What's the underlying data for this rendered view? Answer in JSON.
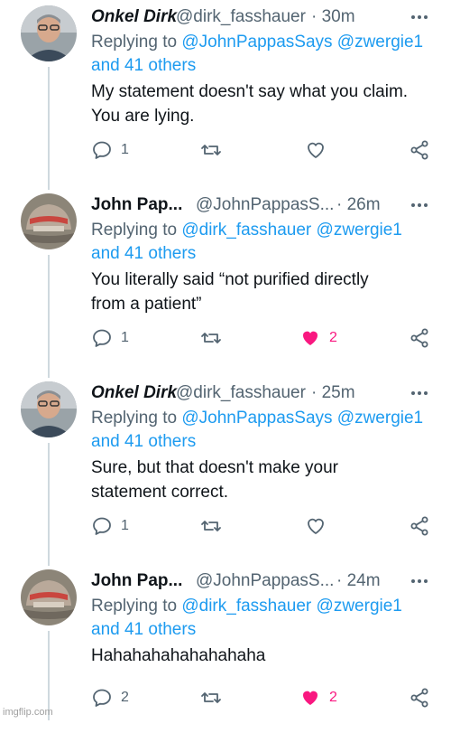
{
  "tweets": [
    {
      "name": "Onkel Dirk",
      "handle": "@dirk_fasshauer",
      "time": "· 30m",
      "replying_to_prefix": "Replying to ",
      "mention_1": "@JohnPappasSays",
      "mention_2": "@zwergie1",
      "and_others": "and 41 others",
      "text_line1": "My statement doesn't say what you claim.",
      "text_line2": "You are lying.",
      "reply_count": "1",
      "retweet_count": "",
      "like_count": "",
      "liked": false
    },
    {
      "name": "John Pap...",
      "handle": "@JohnPappasS...",
      "time": "· 26m",
      "replying_to_prefix": "Replying to ",
      "mention_1": "@dirk_fasshauer",
      "mention_2": "@zwergie1",
      "and_others": "and 41 others",
      "text_line1": "You literally said “not purified directly",
      "text_line2": "from a patient”",
      "reply_count": "1",
      "retweet_count": "",
      "like_count": "2",
      "liked": true
    },
    {
      "name": "Onkel Dirk",
      "handle": "@dirk_fasshauer",
      "time": "· 25m",
      "replying_to_prefix": "Replying to ",
      "mention_1": "@JohnPappasSays",
      "mention_2": "@zwergie1",
      "and_others": "and 41 others",
      "text_line1": "Sure, but that doesn't make your",
      "text_line2": "statement correct.",
      "reply_count": "1",
      "retweet_count": "",
      "like_count": "",
      "liked": false
    },
    {
      "name": "John Pap...",
      "handle": "@JohnPappasS...",
      "time": "· 24m",
      "replying_to_prefix": "Replying to ",
      "mention_1": "@dirk_fasshauer",
      "mention_2": "@zwergie1",
      "and_others": "and 41 others",
      "text_line1": "Hahahahahahahahaha",
      "text_line2": "",
      "reply_count": "2",
      "retweet_count": "",
      "like_count": "2",
      "liked": true
    }
  ],
  "icons": {
    "reply": "reply-icon",
    "retweet": "retweet-icon",
    "like": "heart-icon",
    "share": "share-icon",
    "more": "more-icon"
  },
  "colors": {
    "mention": "#1d9bf0",
    "secondary": "#536471",
    "like_active": "#f91880",
    "thread_line": "#cfd9de"
  },
  "watermark": "imgflip.com"
}
